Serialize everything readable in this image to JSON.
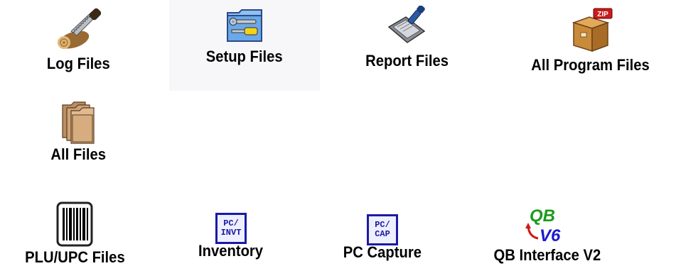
{
  "tiles": {
    "log_files": {
      "label": "Log Files",
      "icon": "log-saw-icon"
    },
    "setup_files": {
      "label": "Setup Files",
      "icon": "wrench-screwdriver-folder-icon"
    },
    "report_files": {
      "label": "Report Files",
      "icon": "report-printer-icon"
    },
    "all_program_files": {
      "label": "All Program Files",
      "icon": "zip-box-icon",
      "badge": "ZIP"
    },
    "all_files": {
      "label": "All Files",
      "icon": "folders-icon"
    },
    "plu_upc_files": {
      "label": "PLU/UPC Files",
      "icon": "barcode-icon"
    },
    "inventory": {
      "label": "Inventory",
      "icon": "pc-invt-icon",
      "icon_text": [
        "PC/",
        "INVT"
      ]
    },
    "pc_capture": {
      "label": "PC Capture",
      "icon": "pc-cap-icon",
      "icon_text": [
        "PC/",
        "CAP"
      ]
    },
    "qb_interface": {
      "label": "QB Interface V2",
      "icon": "qb-v6-icon",
      "icon_text": [
        "QB",
        "V6"
      ]
    }
  },
  "colors": {
    "label": "#000000",
    "pc_icon_blue": "#1a1aa6",
    "qb_green": "#1a9a1a",
    "qb_blue": "#1a1ad0",
    "qb_red": "#d01818",
    "zip_badge": "#c81c1c",
    "box_brown": "#c98a3a"
  }
}
